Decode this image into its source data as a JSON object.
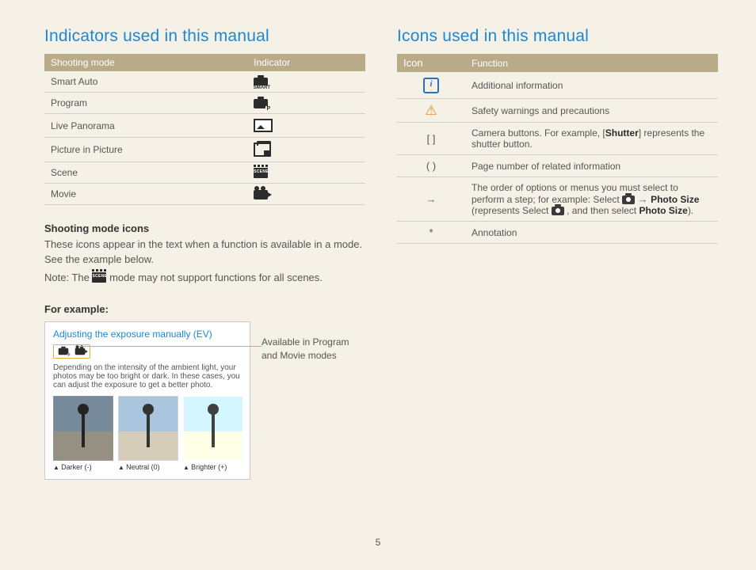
{
  "page_number": "5",
  "left": {
    "heading": "Indicators used in this manual",
    "table": {
      "headers": [
        "Shooting mode",
        "Indicator"
      ],
      "rows": [
        {
          "mode": "Smart Auto",
          "icon": "smart-auto-icon"
        },
        {
          "mode": "Program",
          "icon": "program-icon"
        },
        {
          "mode": "Live Panorama",
          "icon": "panorama-icon"
        },
        {
          "mode": "Picture in Picture",
          "icon": "pip-icon"
        },
        {
          "mode": "Scene",
          "icon": "scene-icon"
        },
        {
          "mode": "Movie",
          "icon": "movie-icon"
        }
      ]
    },
    "sub_heading_1": "Shooting mode icons",
    "body_text_1": "These icons appear in the text when a function is available in a mode. See the example below.",
    "note_prefix": "Note: The ",
    "note_suffix": " mode may not support functions for all scenes.",
    "sub_heading_2": "For example:",
    "example": {
      "title": "Adjusting the exposure manually (EV)",
      "desc": "Depending on the intensity of the ambient light, your photos may be too bright or dark. In these cases, you can adjust the exposure to get a better photo.",
      "thumbs": [
        "Darker (-)",
        "Neutral (0)",
        "Brighter (+)"
      ],
      "callout": "Available in Program and Movie modes"
    }
  },
  "right": {
    "heading": "Icons used in this manual",
    "headers": [
      "Icon",
      "Function"
    ],
    "rows": {
      "info": "Additional information",
      "warn": "Safety warnings and precautions",
      "brackets": {
        "symbol": "[  ]",
        "text_a": "Camera buttons. For example, [",
        "text_b": "Shutter",
        "text_c": "] represents the shutter button."
      },
      "paren": {
        "symbol": "(  )",
        "text": "Page number of related information"
      },
      "arrow": {
        "symbol": "→",
        "line1": "The order of options or menus you must select to perform a step; for example: Select ",
        "ps": "Photo Size",
        "line2": " (represents Select ",
        "line3": ", and then select ",
        "line4": ")."
      },
      "star": {
        "symbol": "*",
        "text": "Annotation"
      }
    }
  }
}
